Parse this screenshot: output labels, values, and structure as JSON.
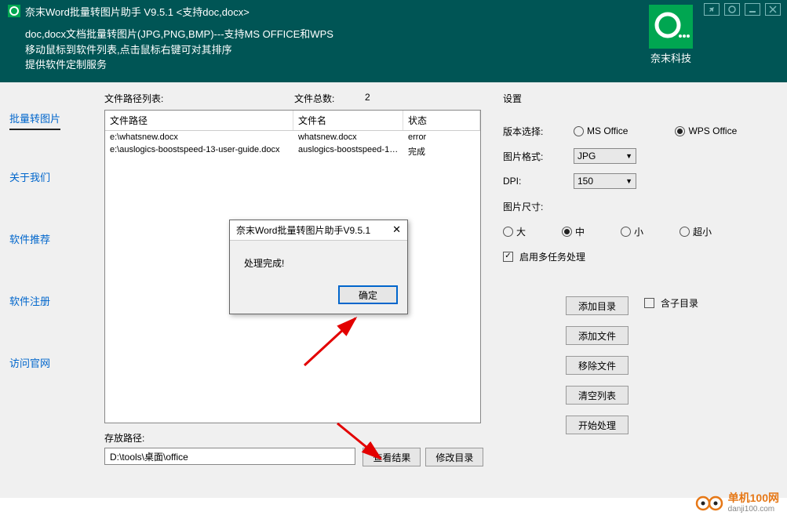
{
  "titlebar": {
    "title": "奈末Word批量转图片助手  V9.5.1    <支持doc,docx>",
    "desc1": "doc,docx文档批量转图片(JPG,PNG,BMP)---支持MS  OFFICE和WPS",
    "desc2": "移动鼠标到软件列表,点击鼠标右键可对其排序",
    "desc3": "提供软件定制服务",
    "brand": "奈末科技"
  },
  "sidebar": {
    "items": [
      "批量转图片",
      "关于我们",
      "软件推荐",
      "软件注册",
      "访问官网"
    ]
  },
  "center": {
    "list_label": "文件路径列表:",
    "count_label": "文件总数:",
    "count_value": "2",
    "columns": {
      "path": "文件路径",
      "name": "文件名",
      "status": "状态"
    },
    "rows": [
      {
        "path": "e:\\whatsnew.docx",
        "name": "whatsnew.docx",
        "status": "error"
      },
      {
        "path": "e:\\auslogics-boostspeed-13-user-guide.docx",
        "name": "auslogics-boostspeed-13...",
        "status": "完成"
      }
    ],
    "save_label": "存放路径:",
    "save_value": "D:\\tools\\桌面\\office",
    "view_result": "查看结果",
    "change_dir": "修改目录"
  },
  "settings": {
    "title": "设置",
    "version_label": "版本选择:",
    "version_options": {
      "ms": "MS Office",
      "wps": "WPS Office"
    },
    "version_selected": "wps",
    "format_label": "图片格式:",
    "format_value": "JPG",
    "dpi_label": "DPI:",
    "dpi_value": "150",
    "size_label": "图片尺寸:",
    "size_options": {
      "l": "大",
      "m": "中",
      "s": "小",
      "xs": "超小"
    },
    "size_selected": "m",
    "multitask": "启用多任务处理",
    "multitask_checked": true,
    "subdir": "含子目录",
    "subdir_checked": false,
    "buttons": {
      "add_dir": "添加目录",
      "add_file": "添加文件",
      "remove_file": "移除文件",
      "clear_list": "清空列表",
      "start": "开始处理"
    }
  },
  "dialog": {
    "title": "奈末Word批量转图片助手V9.5.1",
    "message": "处理完成!",
    "ok": "确定"
  },
  "footer": {
    "name": "单机100网",
    "url": "danji100.com"
  }
}
